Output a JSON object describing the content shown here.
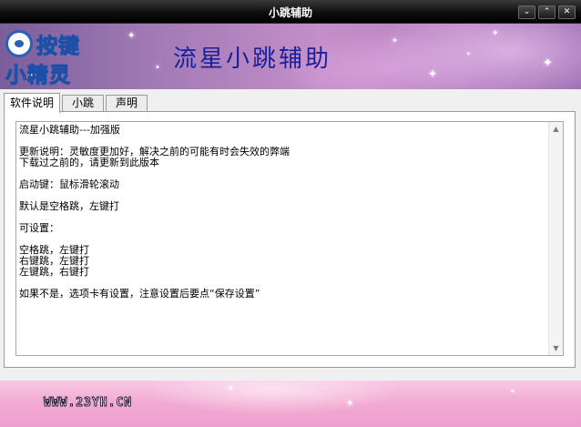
{
  "window": {
    "title": "小跳辅助",
    "controls": {
      "minimize": "⌄",
      "maximize": "⌃",
      "close": "✕"
    }
  },
  "banner": {
    "logo_line1": "按键",
    "logo_line2": "小精灵",
    "title": "流星小跳辅助"
  },
  "tabs": [
    {
      "label": "软件说明",
      "active": true
    },
    {
      "label": "小跳",
      "active": false
    },
    {
      "label": "声明",
      "active": false
    }
  ],
  "content": {
    "lines": "流星小跳辅助---加强版\n\n更新说明：灵敏度更加好，解决之前的可能有时会失效的弊端\n下载过之前的，请更新到此版本\n\n启动键：鼠标滑轮滚动\n\n默认是空格跳，左键打\n\n可设置：\n\n空格跳，左键打\n右键跳，左键打\n左键跳，右键打\n\n如果不是，选项卡有设置，注意设置后要点“保存设置”"
  },
  "footer": {
    "url": "WWW.23YH.CN"
  }
}
